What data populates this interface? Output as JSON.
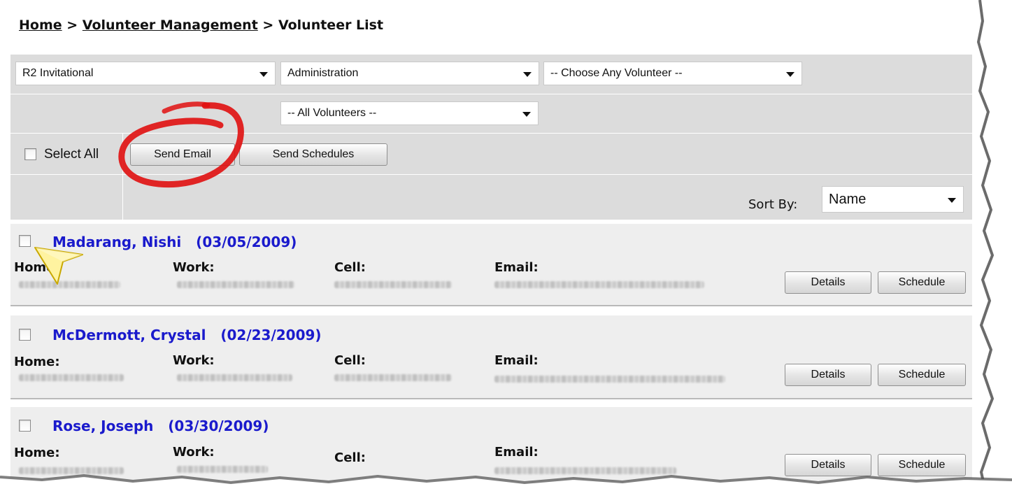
{
  "breadcrumb": {
    "home": "Home",
    "sep1": " > ",
    "volunteer_management": "Volunteer Management",
    "sep2": " > ",
    "current": "Volunteer List"
  },
  "filters": {
    "event": "R2 Invitational",
    "department": "Administration",
    "volunteer": "-- Choose Any Volunteer --",
    "volunteer_group": "-- All Volunteers --"
  },
  "actions": {
    "select_all_label": "Select All",
    "send_email_label": "Send Email",
    "send_schedules_label": "Send Schedules"
  },
  "sort": {
    "label": "Sort By:",
    "value": "Name"
  },
  "field_labels": {
    "home": "Home:",
    "work": "Work:",
    "cell": "Cell:",
    "email": "Email:"
  },
  "volunteers": [
    {
      "name": "Madarang, Nishi",
      "date": "(03/05/2009)",
      "details_label": "Details",
      "schedule_label": "Schedule"
    },
    {
      "name": "McDermott, Crystal",
      "date": "(02/23/2009)",
      "details_label": "Details",
      "schedule_label": "Schedule"
    },
    {
      "name": "Rose, Joseph",
      "date": "(03/30/2009)",
      "details_label": "Details",
      "schedule_label": "Schedule"
    }
  ],
  "colors": {
    "link_blue": "#1a1acc",
    "panel_gray": "#dcdcdc",
    "annotation_red": "#e01010"
  },
  "icons": [
    "dropdown-arrow-icon",
    "cursor-pointer-icon"
  ]
}
